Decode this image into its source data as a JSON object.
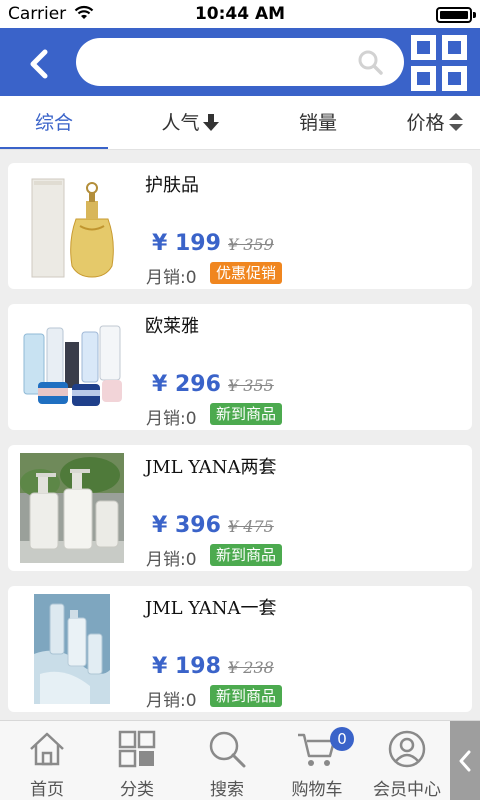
{
  "status_bar": {
    "carrier": "Carrier",
    "time": "10:44 AM",
    "battery_level": 1.0
  },
  "header": {
    "back_icon": "chevron-left-icon",
    "search": {
      "value": "",
      "placeholder": "",
      "icon": "search-icon"
    },
    "qr_icon": "qr-code-icon"
  },
  "tabs": [
    {
      "label": "综合",
      "active": true
    },
    {
      "label": "人气",
      "icon": "arrow-down-icon"
    },
    {
      "label": "销量"
    },
    {
      "label": "价格",
      "icon": "sort-updown-icon"
    }
  ],
  "products": [
    {
      "name": "护肤品",
      "price": "¥ 199",
      "old_price": "¥ 359",
      "sales_label": "月销:",
      "sales": "0",
      "badge": "优惠促销",
      "badge_color": "#f0861f",
      "image": "perfume-bottle"
    },
    {
      "name": "欧莱雅",
      "price": "¥ 296",
      "old_price": "¥ 355",
      "sales_label": "月销:",
      "sales": "0",
      "badge": "新到商品",
      "badge_color": "#4caa4f",
      "image": "cosmetics-set"
    },
    {
      "name": "JML YANA两套",
      "price": "¥ 396",
      "old_price": "¥ 475",
      "sales_label": "月销:",
      "sales": "0",
      "badge": "新到商品",
      "badge_color": "#4caa4f",
      "image": "pump-bottles"
    },
    {
      "name": "JML YANA一套",
      "price": "¥ 198",
      "old_price": "¥ 238",
      "sales_label": "月销:",
      "sales": "0",
      "badge": "新到商品",
      "badge_color": "#4caa4f",
      "image": "bottles-in-water"
    }
  ],
  "bottom_nav": [
    {
      "label": "首页",
      "icon": "home-icon"
    },
    {
      "label": "分类",
      "icon": "category-grid-icon"
    },
    {
      "label": "搜索",
      "icon": "search-icon"
    },
    {
      "label": "购物车",
      "icon": "cart-icon",
      "badge": "0"
    },
    {
      "label": "会员中心",
      "icon": "user-icon"
    }
  ],
  "side_toggle_icon": "chevron-left-icon",
  "colors": {
    "brand": "#3a63c9",
    "promo": "#f0861f",
    "new": "#4caa4f"
  }
}
